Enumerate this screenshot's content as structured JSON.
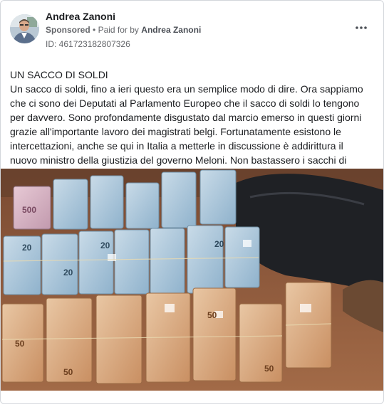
{
  "post": {
    "author": "Andrea Zanoni",
    "sponsored_label": "Sponsored",
    "separator": "•",
    "paid_for_label": "Paid for by",
    "payer": "Andrea Zanoni",
    "id_text": "ID: 461723182807326",
    "more_icon": "more-horizontal-icon",
    "title": "UN SACCO DI SOLDI",
    "body": "Un sacco di soldi, fino a ieri questo era un semplice modo di dire. Ora sappiamo che ci sono dei Deputati al Parlamento Europeo che il sacco di soldi lo tengono per davvero. Sono profondamente disgustato dal marcio emerso in questi giorni grazie all'importante lavoro dei magistrati belgi. Fortunatamente esistono le intercettazioni, anche se qui in Italia a metterle in discussione è addirittura il nuovo ministro della giustizia del governo Meloni. Non bastassero i sacchi di soldi, ci…",
    "banknote_labels": [
      "20",
      "50",
      "500"
    ]
  }
}
